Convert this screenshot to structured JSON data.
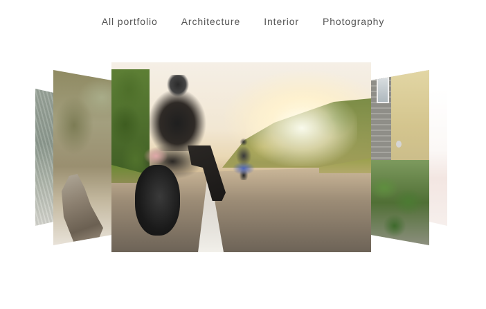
{
  "filters": [
    {
      "label": "All portfolio"
    },
    {
      "label": "Architecture"
    },
    {
      "label": "Interior"
    },
    {
      "label": "Photography"
    }
  ],
  "carousel": {
    "slides": [
      {
        "subject": "foliage-photo"
      },
      {
        "subject": "rock-on-stump-photo"
      },
      {
        "subject": "motorcyclist-on-road-photo"
      },
      {
        "subject": "house-wall-with-bushes-photo"
      },
      {
        "subject": "faded-photo"
      }
    ],
    "active_slide": 3
  },
  "colors": {
    "background": "#ffffff",
    "filter_text": "#555555"
  }
}
